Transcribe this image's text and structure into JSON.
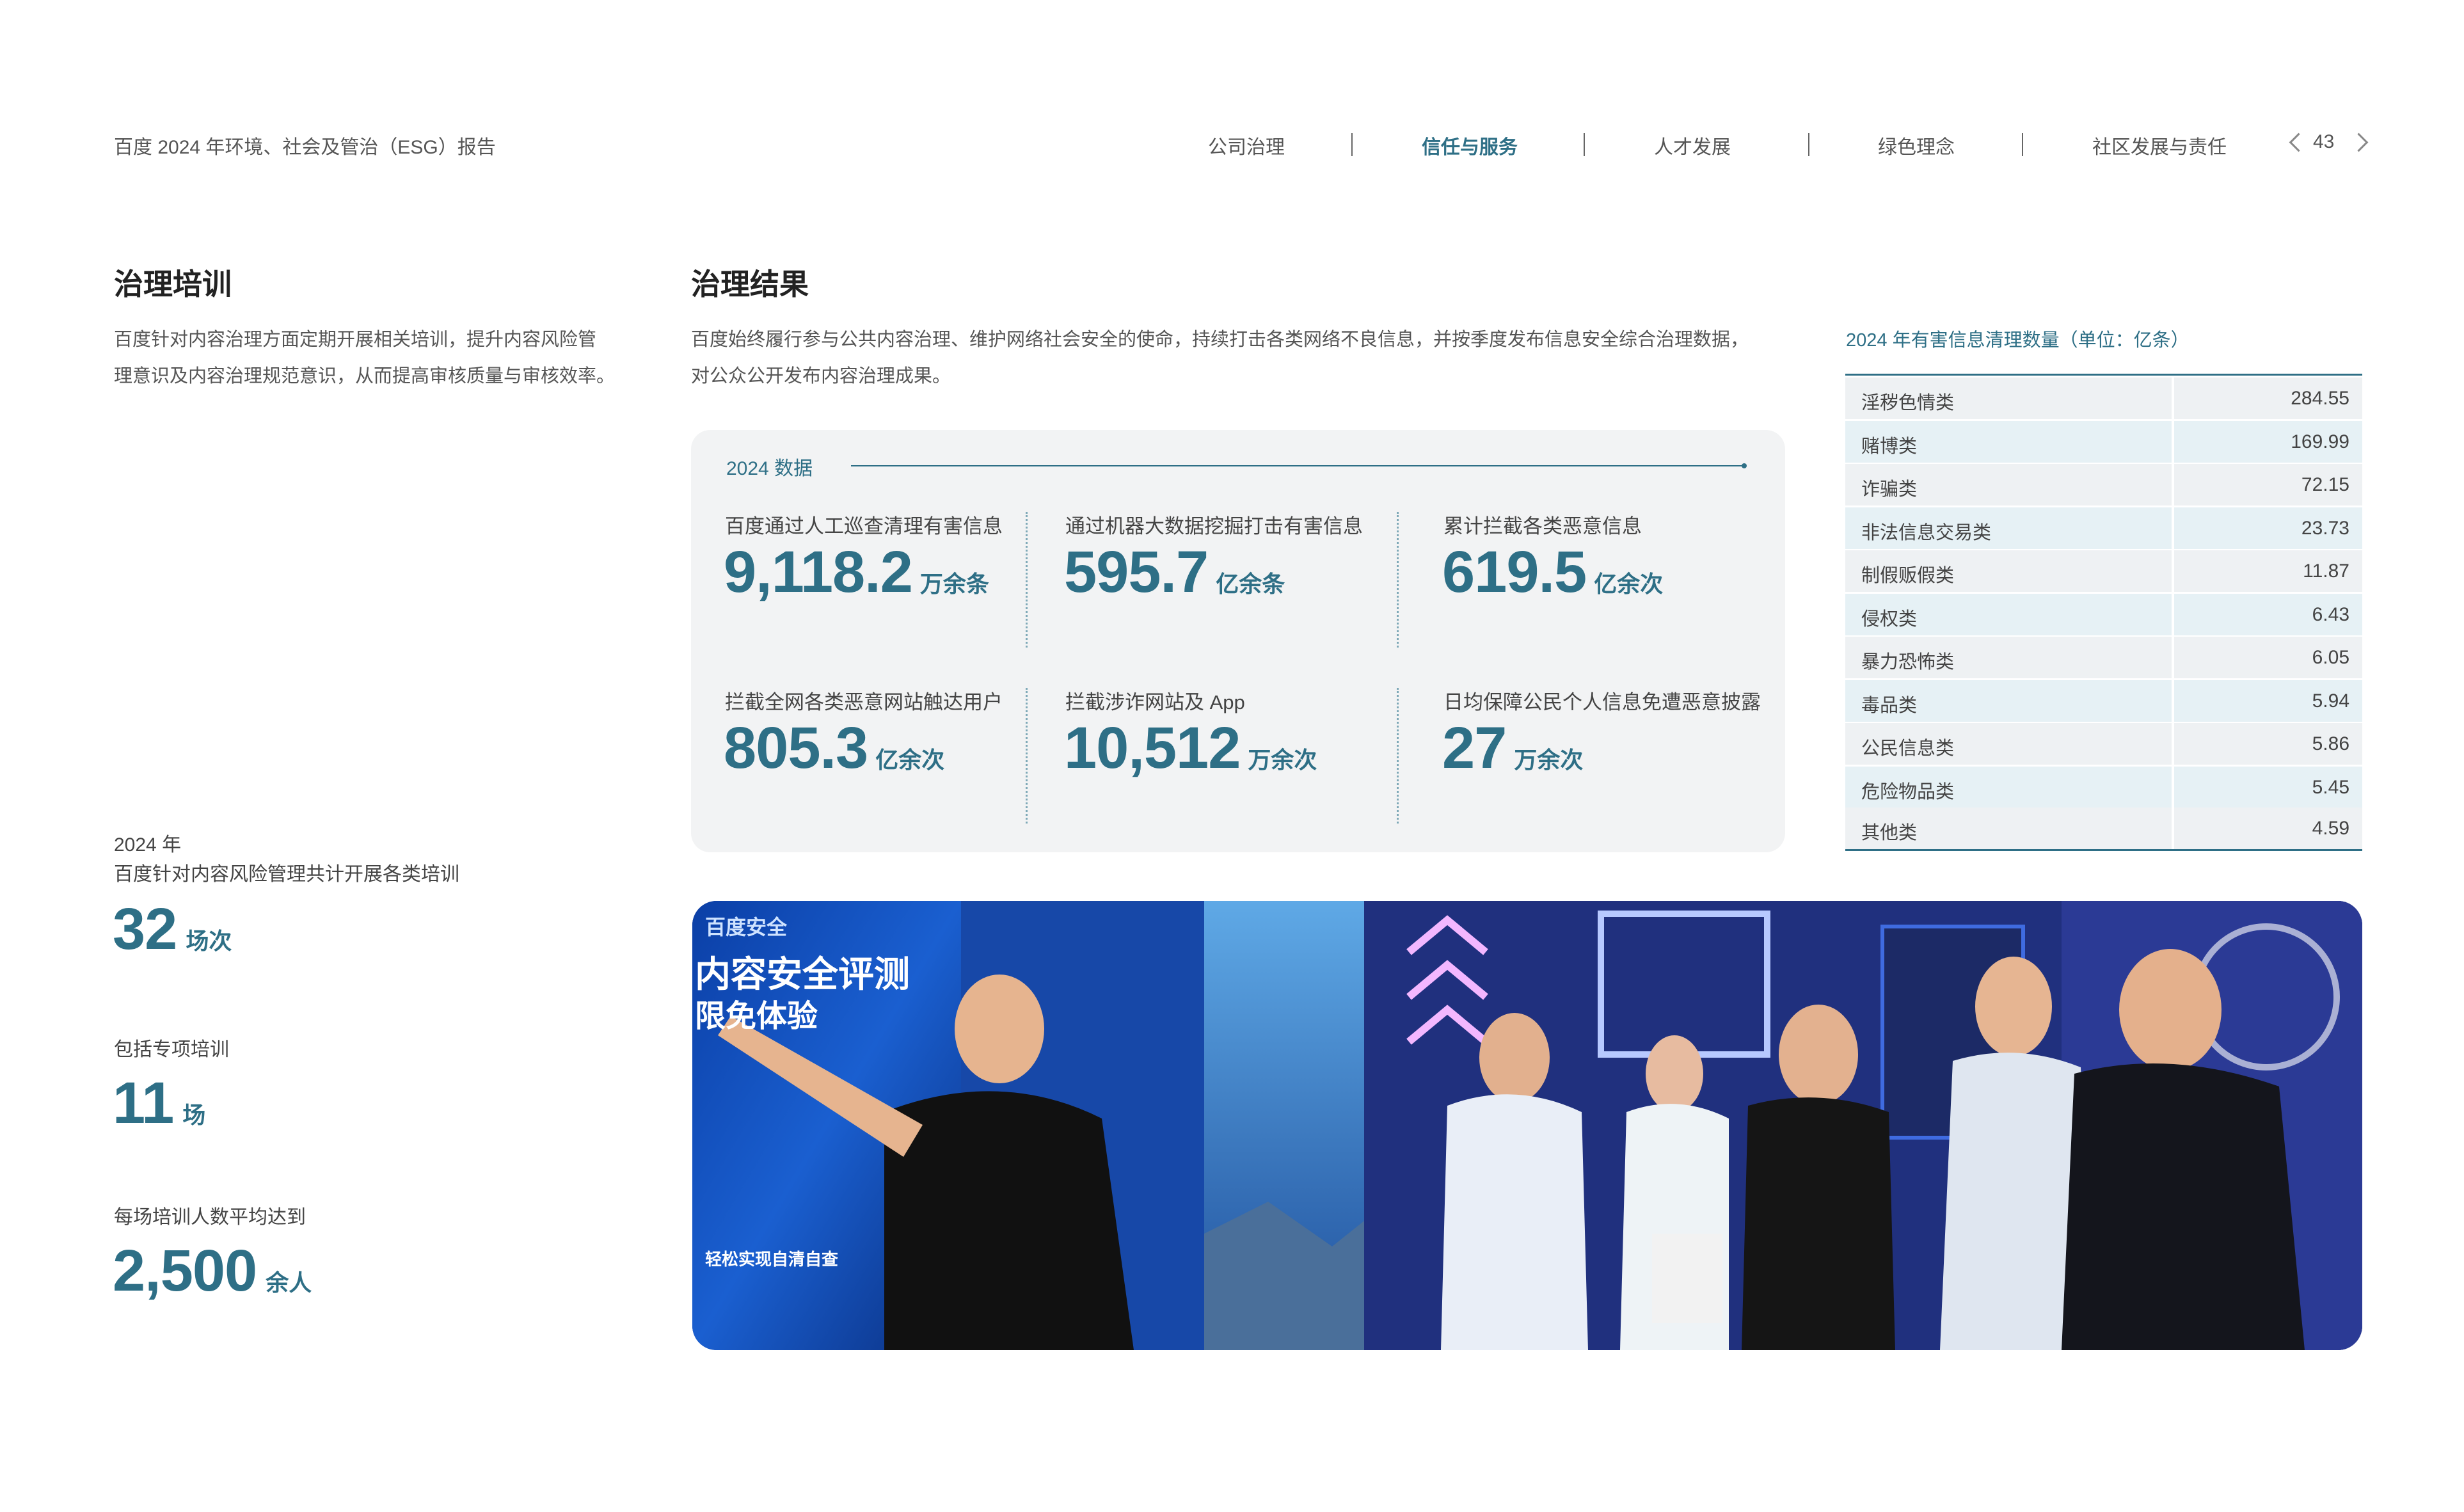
{
  "header": {
    "report_title": "百度 2024 年环境、社会及管治（ESG）报告",
    "nav": [
      "公司治理",
      "信任与服务",
      "人才发展",
      "绿色理念",
      "社区发展与责任"
    ],
    "active_nav": "信任与服务",
    "page_number": "43"
  },
  "training": {
    "heading": "治理培训",
    "description_line1": "百度针对内容治理方面定期开展相关培训，提升内容风险管",
    "description_line2": "理意识及内容治理规范意识，从而提高审核质量与审核效率。",
    "year_label": "2024 年",
    "intro_label": "百度针对内容风险管理共计开展各类培训",
    "stats": [
      {
        "num": "32",
        "unit": "场次"
      },
      {
        "label": "包括专项培训",
        "num": "11",
        "unit": "场"
      },
      {
        "label": "每场培训人数平均达到",
        "num": "2,500",
        "unit": "余人"
      }
    ]
  },
  "results": {
    "heading": "治理结果",
    "description_line1": "百度始终履行参与公共内容治理、维护网络社会安全的使命，持续打击各类网络不良信息，并按季度发布信息安全综合治理数据，",
    "description_line2": "对公众公开发布内容治理成果。",
    "box_title": "2024 数据",
    "cells": [
      {
        "label": "百度通过人工巡查清理有害信息",
        "num": "9,118.2",
        "unit": "万余条"
      },
      {
        "label": "通过机器大数据挖掘打击有害信息",
        "num": "595.7",
        "unit": "亿余条"
      },
      {
        "label": "累计拦截各类恶意信息",
        "num": "619.5",
        "unit": "亿余次"
      },
      {
        "label": "拦截全网各类恶意网站触达用户",
        "num": "805.3",
        "unit": "亿余次"
      },
      {
        "label": "拦截涉诈网站及 App",
        "num": "10,512",
        "unit": "万余次"
      },
      {
        "label": "日均保障公民个人信息免遭恶意披露",
        "num": "27",
        "unit": "万余次"
      }
    ]
  },
  "table": {
    "title": "2024 年有害信息清理数量（单位：亿条）",
    "rows": [
      {
        "category": "淫秽色情类",
        "value": "284.55"
      },
      {
        "category": "赌博类",
        "value": "169.99"
      },
      {
        "category": "诈骗类",
        "value": "72.15"
      },
      {
        "category": "非法信息交易类",
        "value": "23.73"
      },
      {
        "category": "制假贩假类",
        "value": "11.87"
      },
      {
        "category": "侵权类",
        "value": "6.43"
      },
      {
        "category": "暴力恐怖类",
        "value": "6.05"
      },
      {
        "category": "毒品类",
        "value": "5.94"
      },
      {
        "category": "公民信息类",
        "value": "5.86"
      },
      {
        "category": "危险物品类",
        "value": "5.45"
      },
      {
        "category": "其他类",
        "value": "4.59"
      }
    ]
  },
  "photo": {
    "sign_title": "内容安全评测",
    "sign_subtitle": "限免体验",
    "sign_brand": "百度安全",
    "sign_bottom": "轻松实现自清自查"
  },
  "colors": {
    "accent": "#2e6f86",
    "table_band": "#e6f1f5",
    "box_bg": "#f2f3f4"
  }
}
